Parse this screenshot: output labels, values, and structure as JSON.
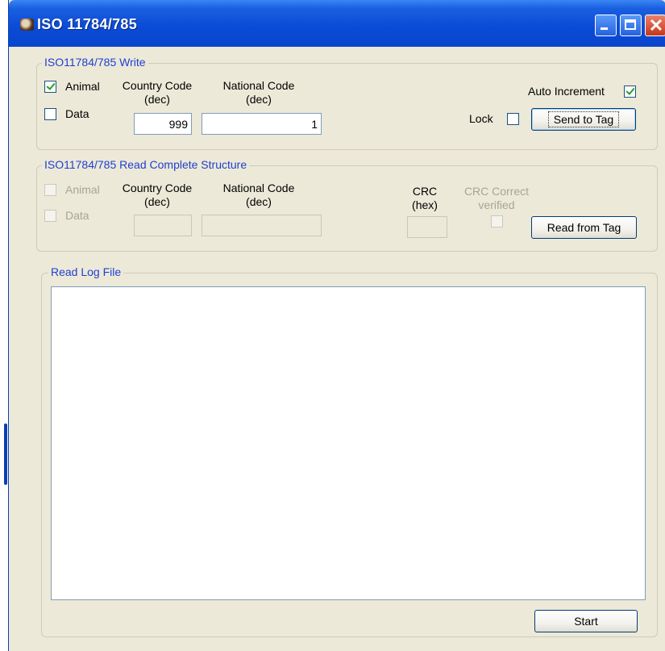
{
  "window": {
    "title": "ISO 11784/785",
    "icon": "app-icon",
    "controls": [
      "minimize-icon",
      "maximize-icon",
      "close-icon"
    ],
    "colors": {
      "titlebar": "#0a4ad6",
      "face": "#ece9d8",
      "legend": "#1f3fd0",
      "check": "#21a121"
    }
  },
  "write_group": {
    "legend": "ISO11784/785 Write",
    "animal_label": "Animal",
    "animal_checked": true,
    "data_label": "Data",
    "data_checked": false,
    "country_code_label_line1": "Country Code",
    "country_code_label_line2": "(dec)",
    "national_code_label_line1": "National Code",
    "national_code_label_line2": "(dec)",
    "country_code_value": "999",
    "national_code_value": "1",
    "auto_increment_label": "Auto Increment",
    "auto_increment_checked": true,
    "lock_label": "Lock",
    "lock_checked": false,
    "send_button": "Send to Tag"
  },
  "read_group": {
    "legend": "ISO11784/785 Read Complete Structure",
    "animal_label": "Animal",
    "data_label": "Data",
    "country_code_label_line1": "Country Code",
    "country_code_label_line2": "(dec)",
    "national_code_label_line1": "National Code",
    "national_code_label_line2": "(dec)",
    "crc_label_line1": "CRC",
    "crc_label_line2": "(hex)",
    "crc_correct_label_line1": "CRC Correct",
    "crc_correct_label_line2": "verified",
    "read_button": "Read from Tag"
  },
  "log_group": {
    "legend": "Read Log File",
    "log_text": "",
    "start_button": "Start"
  }
}
